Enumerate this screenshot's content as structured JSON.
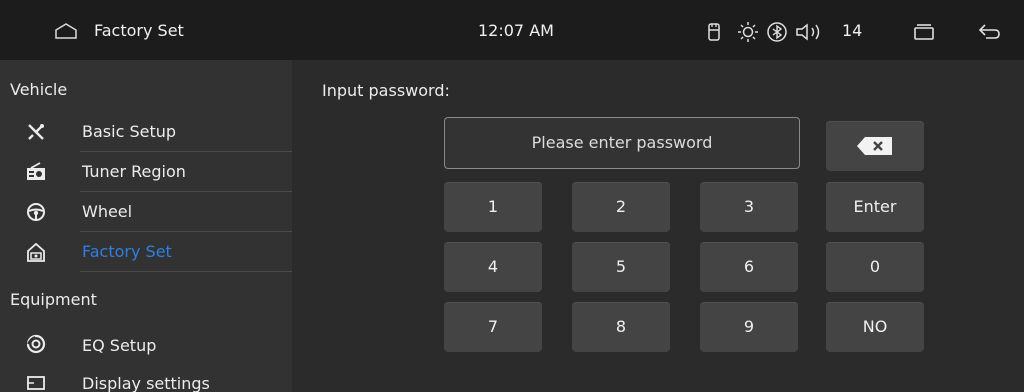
{
  "statusbar": {
    "title": "Factory Set",
    "time": "12:07 AM",
    "volume": "14",
    "icons": [
      "home-icon",
      "usb-icon",
      "brightness-icon",
      "bluetooth-icon",
      "speaker-icon",
      "recent-apps-icon",
      "back-icon"
    ]
  },
  "sidebar": {
    "vehicle_heading": "Vehicle",
    "items": [
      {
        "label": "Basic Setup",
        "icon": "tools-icon"
      },
      {
        "label": "Tuner Region",
        "icon": "radio-icon"
      },
      {
        "label": "Wheel",
        "icon": "steering-wheel-icon"
      },
      {
        "label": "Factory Set",
        "icon": "factory-icon",
        "active": true
      }
    ],
    "equipment_heading": "Equipment",
    "equipment_items": [
      {
        "label": "EQ Setup",
        "icon": "eq-icon"
      },
      {
        "label": "Display settings",
        "icon": "display-icon"
      }
    ]
  },
  "main": {
    "prompt": "Input password:",
    "password_placeholder": "Please enter password",
    "keys": {
      "k1": "1",
      "k2": "2",
      "k3": "3",
      "enter": "Enter",
      "k4": "4",
      "k5": "5",
      "k6": "6",
      "k0": "0",
      "k7": "7",
      "k8": "8",
      "k9": "9",
      "no": "NO"
    }
  },
  "colors": {
    "accent": "#2f7fe0",
    "background": "#2b2b2b",
    "statusbar": "#1c1c1c",
    "sidebar": "#323232",
    "key": "#444444"
  }
}
